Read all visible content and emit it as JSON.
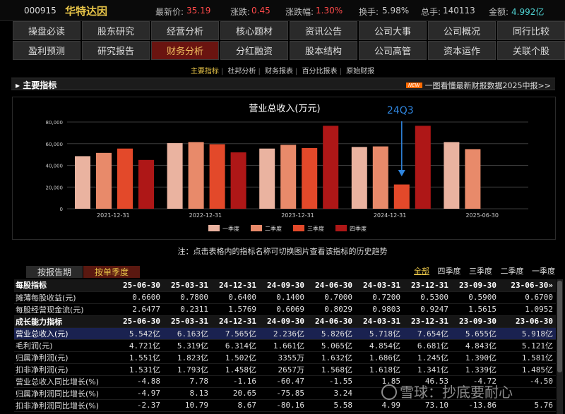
{
  "quote": {
    "code": "000915",
    "name": "华特达因",
    "price_label": "最新价:",
    "price": "35.19",
    "change_label": "涨跌:",
    "change": "0.45",
    "change_pct_label": "涨跌幅:",
    "change_pct": "1.30%",
    "turnover_label": "换手:",
    "turnover": "5.98%",
    "volume_label": "总手:",
    "volume": "140113",
    "amount_label": "金额:",
    "amount": "4.992亿"
  },
  "nav": {
    "row1": [
      "操盘必读",
      "股东研究",
      "经营分析",
      "核心题材",
      "资讯公告",
      "公司大事",
      "公司概况",
      "同行比较"
    ],
    "row2": [
      "盈利预测",
      "研究报告",
      "财务分析",
      "分红融资",
      "股本结构",
      "公司高管",
      "资本运作",
      "关联个股"
    ],
    "active": "财务分析"
  },
  "subtabs": [
    "主要指标",
    "杜邦分析",
    "财务报表",
    "百分比报表",
    "原始财报"
  ],
  "section": {
    "title": "主要指标",
    "badge": "NEW",
    "promo": "一图看懂最新财报数据2025中报>>"
  },
  "chart_data": {
    "type": "bar",
    "title": "营业总收入(万元)",
    "annotation": "24Q3",
    "categories": [
      "2021-12-31",
      "2022-12-31",
      "2023-12-31",
      "2024-12-31",
      "2025-06-30"
    ],
    "yticks": [
      "80,000",
      "60,000",
      "40,000",
      "20,000",
      "0"
    ],
    "ylim": [
      0,
      80000
    ],
    "series": [
      {
        "name": "一季度",
        "color": "#eab3a0",
        "values": [
          48500,
          60500,
          55500,
          57000,
          61500
        ]
      },
      {
        "name": "二季度",
        "color": "#e88a6a",
        "values": [
          51500,
          61500,
          59000,
          57500,
          55000
        ]
      },
      {
        "name": "三季度",
        "color": "#e3492a",
        "values": [
          55500,
          59500,
          56000,
          22400,
          null
        ]
      },
      {
        "name": "四季度",
        "color": "#ae1717",
        "values": [
          45000,
          52000,
          76500,
          76500,
          null
        ]
      }
    ],
    "legend_position": "bottom"
  },
  "note": "注：点击表格内的指标名称可切换图片查看该指标的历史趋势",
  "report_tabs": [
    "按报告期",
    "按单季度"
  ],
  "quarter_filter": [
    "全部",
    "四季度",
    "三季度",
    "二季度",
    "一季度"
  ],
  "table": {
    "rows": [
      {
        "kind": "hdr",
        "cells": [
          "每股指标",
          "25-06-30",
          "25-03-31",
          "24-12-31",
          "24-09-30",
          "24-06-30",
          "24-03-31",
          "23-12-31",
          "23-09-30",
          "23-06-30»"
        ]
      },
      {
        "kind": "row",
        "cells": [
          "摊薄每股收益(元)",
          "0.6600",
          "0.7800",
          "0.6400",
          "0.1400",
          "0.7000",
          "0.7200",
          "0.5300",
          "0.5900",
          "0.6700"
        ]
      },
      {
        "kind": "row",
        "cells": [
          "每股经营现金流(元)",
          "2.6477",
          "0.2311",
          "1.5769",
          "0.6069",
          "0.8029",
          "0.9803",
          "0.9247",
          "1.5615",
          "1.0952"
        ]
      },
      {
        "kind": "hdr",
        "cells": [
          "成长能力指标",
          "25-06-30",
          "25-03-31",
          "24-12-31",
          "24-09-30",
          "24-06-30",
          "24-03-31",
          "23-12-31",
          "23-09-30",
          "23-06-30"
        ]
      },
      {
        "kind": "sel",
        "cells": [
          "营业总收入(元)",
          "5.542亿",
          "6.163亿",
          "7.565亿",
          "2.236亿",
          "5.826亿",
          "5.718亿",
          "7.654亿",
          "5.655亿",
          "5.918亿"
        ]
      },
      {
        "kind": "row",
        "cells": [
          "毛利润(元)",
          "4.721亿",
          "5.319亿",
          "6.314亿",
          "1.661亿",
          "5.065亿",
          "4.854亿",
          "6.681亿",
          "4.843亿",
          "5.121亿"
        ]
      },
      {
        "kind": "row",
        "cells": [
          "归属净利润(元)",
          "1.551亿",
          "1.823亿",
          "1.502亿",
          "3355万",
          "1.632亿",
          "1.686亿",
          "1.245亿",
          "1.390亿",
          "1.581亿"
        ]
      },
      {
        "kind": "row",
        "cells": [
          "扣非净利润(元)",
          "1.531亿",
          "1.793亿",
          "1.458亿",
          "2657万",
          "1.568亿",
          "1.618亿",
          "1.341亿",
          "1.339亿",
          "1.485亿"
        ]
      },
      {
        "kind": "row",
        "cells": [
          "营业总收入同比增长(%)",
          "-4.88",
          "7.78",
          "-1.16",
          "-60.47",
          "-1.55",
          "1.85",
          "46.53",
          "-4.72",
          "-4.50"
        ]
      },
      {
        "kind": "row",
        "cells": [
          "归属净利润同比增长(%)",
          "-4.97",
          "8.13",
          "20.65",
          "-75.85",
          "3.24",
          "",
          "",
          "",
          ""
        ]
      },
      {
        "kind": "row",
        "cells": [
          "扣非净利润同比增长(%)",
          "-2.37",
          "10.79",
          "8.67",
          "-80.16",
          "5.58",
          "4.99",
          "73.10",
          "-13.86",
          "5.76"
        ]
      }
    ]
  },
  "watermark": "雪球：抄底要耐心"
}
